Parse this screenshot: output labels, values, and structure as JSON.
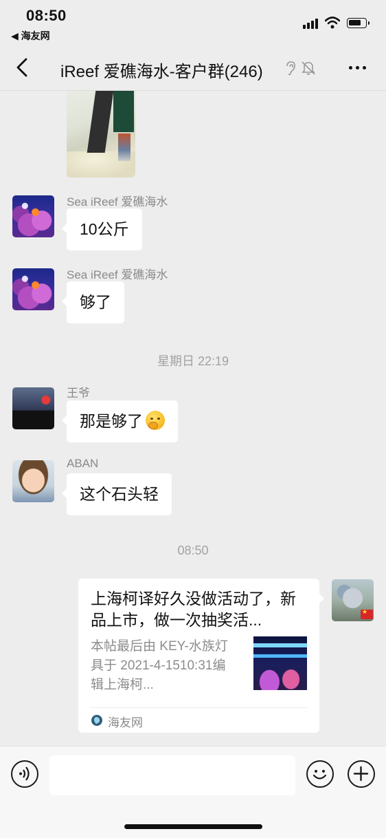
{
  "status_bar": {
    "time": "08:50",
    "back_app": "◀ 海友网",
    "icons": [
      "cellular-signal-icon",
      "wifi-icon",
      "battery-icon"
    ]
  },
  "nav": {
    "title": "iReef 爱礁海水-客户群(246)",
    "icons": [
      "back-arrow-icon",
      "ear-icon",
      "mute-bell-icon",
      "more-icon"
    ]
  },
  "messages": [
    {
      "type": "image",
      "sender": "self_prior",
      "description_icon": "photo"
    },
    {
      "type": "text",
      "sender": "Sea iReef 爱礁海水",
      "text": "10公斤"
    },
    {
      "type": "text",
      "sender": "Sea iReef 爱礁海水",
      "text": "够了"
    },
    {
      "type": "timestamp",
      "text": "星期日 22:19"
    },
    {
      "type": "text",
      "sender": "王爷",
      "text": "那是够了",
      "emoji": "thinking-face-icon"
    },
    {
      "type": "text",
      "sender": "ABAN",
      "text": "这个石头轻"
    },
    {
      "type": "timestamp",
      "text": "08:50"
    }
  ],
  "link_card": {
    "title": "上海柯译好久没做活动了，新品上市，做一次抽奖活...",
    "description": "本帖最后由 KEY-水族灯具于 2021-4-1510:31编辑上海柯...",
    "source": "海友网"
  },
  "input_bar": {
    "placeholder": "",
    "icons": [
      "voice-icon",
      "emoji-icon",
      "plus-icon"
    ]
  },
  "colors": {
    "background": "#ededed",
    "bubble": "#ffffff",
    "meta_text": "#8a8a8a"
  }
}
